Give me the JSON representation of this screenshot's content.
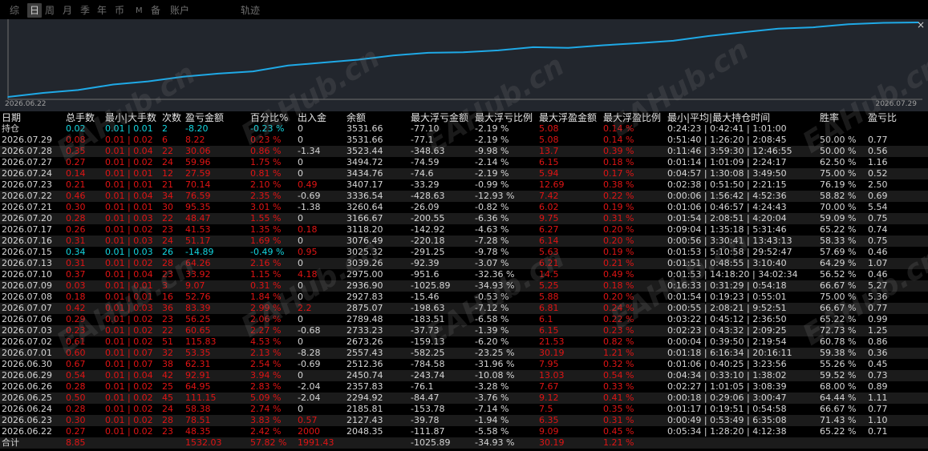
{
  "tabs": [
    {
      "label": "综",
      "active": false
    },
    {
      "label": "日",
      "active": true
    },
    {
      "label": "周",
      "active": false
    },
    {
      "label": "月",
      "active": false
    },
    {
      "label": "季",
      "active": false
    },
    {
      "label": "年",
      "active": false
    },
    {
      "label": "币",
      "active": false
    },
    {
      "label": "M",
      "active": false
    },
    {
      "label": "备",
      "active": false
    },
    {
      "label": "账户",
      "active": false
    },
    {
      "label": "轨迹",
      "active": false
    }
  ],
  "chart": {
    "close_label": "×",
    "x_start_label": "2026.06.22",
    "x_end_label": "2026.07.29",
    "line_color": "#1fa9e6",
    "background": "#22262d",
    "chart_data": {
      "type": "line",
      "x": [
        "2026.06.22",
        "2026.06.23",
        "2026.06.24",
        "2026.06.25",
        "2026.06.26",
        "2026.06.29",
        "2026.06.30",
        "2026.07.01",
        "2026.07.02",
        "2026.07.03",
        "2026.07.06",
        "2026.07.07",
        "2026.07.08",
        "2026.07.09",
        "2026.07.10",
        "2026.07.13",
        "2026.07.15",
        "2026.07.16",
        "2026.07.17",
        "2026.07.20",
        "2026.07.21",
        "2026.07.22",
        "2026.07.23",
        "2026.07.24",
        "2026.07.27",
        "2026.07.28",
        "2026.07.29"
      ],
      "values": [
        2048.35,
        2127.43,
        2185.81,
        2294.92,
        2357.83,
        2450.74,
        2512.36,
        2557.43,
        2673.26,
        2733.23,
        2789.48,
        2875.07,
        2927.83,
        2936.9,
        2975.0,
        3039.26,
        3025.32,
        3076.49,
        3118.2,
        3166.67,
        3260.64,
        3336.54,
        3407.37,
        3434.76,
        3494.72,
        3523.44,
        3531.66
      ]
    }
  },
  "headers": [
    "日期",
    "总手数",
    "最小|大手数",
    "次数",
    "盈亏金额",
    "百分比%",
    "出入金",
    "余额",
    "最大浮亏金额",
    "最大浮亏比例",
    "最大浮盈金额",
    "最大浮盈比例",
    "最小|平均|最大持仓时间",
    "胜率",
    "盈亏比"
  ],
  "holding": [
    "持仓",
    "0.02",
    "0.01 | 0.01",
    "2",
    "-8.20",
    "-0.23 %",
    "0",
    "3531.66",
    "-77.10",
    "-2.19 %",
    "5.08",
    "0.14 %",
    "0:24:23 | 0:42:41 | 1:01:00",
    "",
    ""
  ],
  "rows": [
    [
      "2026.07.29",
      "0.08",
      "0.01 | 0.02",
      "6",
      "8.22",
      "0.23 %",
      "0",
      "3531.66",
      "-77.1",
      "-2.19 %",
      "5.08",
      "0.14 %",
      "0:51:40 | 1:26:20 | 2:08:45",
      "50.00 %",
      "0.77"
    ],
    [
      "2026.07.28",
      "0.35",
      "0.01 | 0.04",
      "22",
      "30.06",
      "0.86 %",
      "-1.34",
      "3523.44",
      "-348.63",
      "-9.98 %",
      "13.7",
      "0.39 %",
      "0:11:46 | 3:59:30 | 12:46:55",
      "50.00 %",
      "0.56"
    ],
    [
      "2026.07.27",
      "0.27",
      "0.01 | 0.02",
      "24",
      "59.96",
      "1.75 %",
      "0",
      "3494.72",
      "-74.59",
      "-2.14 %",
      "6.15",
      "0.18 %",
      "0:01:14 | 1:01:09 | 2:24:17",
      "62.50 %",
      "1.16"
    ],
    [
      "2026.07.24",
      "0.14",
      "0.01 | 0.01",
      "12",
      "27.59",
      "0.81 %",
      "0",
      "3434.76",
      "-74.6",
      "-2.19 %",
      "5.94",
      "0.17 %",
      "0:04:57 | 1:30:08 | 3:49:50",
      "75.00 %",
      "0.52"
    ],
    [
      "2026.07.23",
      "0.21",
      "0.01 | 0.01",
      "21",
      "70.14",
      "2.10 %",
      "0.49",
      "3407.17",
      "-33.29",
      "-0.99 %",
      "12.69",
      "0.38 %",
      "0:02:38 | 0:51:50 | 2:21:15",
      "76.19 %",
      "2.50"
    ],
    [
      "2026.07.22",
      "0.46",
      "0.01 | 0.04",
      "34",
      "76.59",
      "2.35 %",
      "-0.69",
      "3336.54",
      "-428.63",
      "-12.93 %",
      "7.42",
      "0.22 %",
      "0:00:06 | 1:56:42 | 4:52:36",
      "58.82 %",
      "0.69"
    ],
    [
      "2026.07.21",
      "0.30",
      "0.01 | 0.01",
      "30",
      "95.35",
      "3.01 %",
      "-1.38",
      "3260.64",
      "-26.09",
      "-0.82 %",
      "6.02",
      "0.19 %",
      "0:01:06 | 0:46:57 | 4:24:43",
      "70.00 %",
      "5.54"
    ],
    [
      "2026.07.20",
      "0.28",
      "0.01 | 0.03",
      "22",
      "48.47",
      "1.55 %",
      "0",
      "3166.67",
      "-200.55",
      "-6.36 %",
      "9.75",
      "0.31 %",
      "0:01:54 | 2:08:51 | 4:20:04",
      "59.09 %",
      "0.75"
    ],
    [
      "2026.07.17",
      "0.26",
      "0.01 | 0.02",
      "23",
      "41.53",
      "1.35 %",
      "0.18",
      "3118.20",
      "-142.92",
      "-4.63 %",
      "6.27",
      "0.20 %",
      "0:09:04 | 1:35:18 | 5:31:46",
      "65.22 %",
      "0.74"
    ],
    [
      "2026.07.16",
      "0.31",
      "0.01 | 0.03",
      "24",
      "51.17",
      "1.69 %",
      "0",
      "3076.49",
      "-220.18",
      "-7.28 %",
      "6.14",
      "0.20 %",
      "0:00:56 | 3:30:41 | 13:43:13",
      "58.33 %",
      "0.75"
    ],
    [
      "2026.07.15",
      "0.34",
      "0.01 | 0.03",
      "26",
      "-14.89",
      "-0.49 %",
      "0.95",
      "3025.32",
      "-291.25",
      "-9.78 %",
      "5.63",
      "0.19 %",
      "0:01:53 | 5:10:58 | 29:52:47",
      "57.69 %",
      "0.46"
    ],
    [
      "2026.07.13",
      "0.31",
      "0.01 | 0.02",
      "28",
      "64.26",
      "2.16 %",
      "0",
      "3039.26",
      "-92.39",
      "-3.07 %",
      "6.21",
      "0.21 %",
      "0:01:51 | 0:48:55 | 3:10:40",
      "64.29 %",
      "1.07"
    ],
    [
      "2026.07.10",
      "0.37",
      "0.01 | 0.04",
      "23",
      "33.92",
      "1.15 %",
      "4.18",
      "2975.00",
      "-951.6",
      "-32.36 %",
      "14.5",
      "0.49 %",
      "0:01:53 | 14:18:20 | 34:02:34",
      "56.52 %",
      "0.46"
    ],
    [
      "2026.07.09",
      "0.03",
      "0.01 | 0.01",
      "3",
      "9.07",
      "0.31 %",
      "0",
      "2936.90",
      "-1025.89",
      "-34.93 %",
      "5.25",
      "0.18 %",
      "0:16:33 | 0:31:29 | 0:54:18",
      "66.67 %",
      "5.27"
    ],
    [
      "2026.07.08",
      "0.18",
      "0.01 | 0.01",
      "16",
      "52.76",
      "1.84 %",
      "0",
      "2927.83",
      "-15.46",
      "-0.53 %",
      "5.88",
      "0.20 %",
      "0:01:54 | 0:19:23 | 0:55:01",
      "75.00 %",
      "5.36"
    ],
    [
      "2026.07.07",
      "0.42",
      "0.01 | 0.03",
      "36",
      "83.39",
      "2.99 %",
      "2.2",
      "2875.07",
      "-198.63",
      "-7.12 %",
      "6.81",
      "0.24 %",
      "0:00:55 | 2:08:21 | 9:52:51",
      "66.67 %",
      "0.77"
    ],
    [
      "2026.07.06",
      "0.29",
      "0.01 | 0.02",
      "23",
      "56.25",
      "2.06 %",
      "0",
      "2789.48",
      "-183.51",
      "-6.58 %",
      "6.1",
      "0.22 %",
      "0:03:22 | 0:45:12 | 2:36:50",
      "65.22 %",
      "0.99"
    ],
    [
      "2026.07.03",
      "0.23",
      "0.01 | 0.02",
      "22",
      "60.65",
      "2.27 %",
      "-0.68",
      "2733.23",
      "-37.73",
      "-1.39 %",
      "6.15",
      "0.23 %",
      "0:02:23 | 0:43:32 | 2:09:25",
      "72.73 %",
      "1.25"
    ],
    [
      "2026.07.02",
      "0.61",
      "0.01 | 0.02",
      "51",
      "115.83",
      "4.53 %",
      "0",
      "2673.26",
      "-159.13",
      "-6.20 %",
      "21.53",
      "0.82 %",
      "0:00:04 | 0:39:50 | 2:19:54",
      "60.78 %",
      "0.86"
    ],
    [
      "2026.07.01",
      "0.60",
      "0.01 | 0.07",
      "32",
      "53.35",
      "2.13 %",
      "-8.28",
      "2557.43",
      "-582.25",
      "-23.25 %",
      "30.19",
      "1.21 %",
      "0:01:18 | 6:16:34 | 20:16:11",
      "59.38 %",
      "0.36"
    ],
    [
      "2026.06.30",
      "0.67",
      "0.01 | 0.07",
      "38",
      "62.31",
      "2.54 %",
      "-0.69",
      "2512.36",
      "-784.58",
      "-31.96 %",
      "7.95",
      "0.32 %",
      "0:01:06 | 0:40:25 | 3:23:56",
      "55.26 %",
      "0.45"
    ],
    [
      "2026.06.29",
      "0.54",
      "0.01 | 0.04",
      "42",
      "92.91",
      "3.94 %",
      "0",
      "2450.74",
      "-243.74",
      "-10.08 %",
      "13.03",
      "0.54 %",
      "0:04:34 | 0:33:10 | 1:38:02",
      "59.52 %",
      "0.73"
    ],
    [
      "2026.06.26",
      "0.28",
      "0.01 | 0.02",
      "25",
      "64.95",
      "2.83 %",
      "-2.04",
      "2357.83",
      "-76.1",
      "-3.28 %",
      "7.67",
      "0.33 %",
      "0:02:27 | 1:01:05 | 3:08:39",
      "68.00 %",
      "0.89"
    ],
    [
      "2026.06.25",
      "0.50",
      "0.01 | 0.02",
      "45",
      "111.15",
      "5.09 %",
      "-2.04",
      "2294.92",
      "-84.47",
      "-3.76 %",
      "9.12",
      "0.41 %",
      "0:00:18 | 0:29:06 | 3:00:47",
      "64.44 %",
      "1.11"
    ],
    [
      "2026.06.24",
      "0.28",
      "0.01 | 0.02",
      "24",
      "58.38",
      "2.74 %",
      "0",
      "2185.81",
      "-153.78",
      "-7.14 %",
      "7.5",
      "0.35 %",
      "0:01:17 | 0:19:51 | 0:54:58",
      "66.67 %",
      "0.77"
    ],
    [
      "2026.06.23",
      "0.30",
      "0.01 | 0.02",
      "28",
      "78.51",
      "3.83 %",
      "0.57",
      "2127.43",
      "-39.78",
      "-1.94 %",
      "6.35",
      "0.31 %",
      "0:00:49 | 0:53:49 | 6:35:08",
      "71.43 %",
      "1.10"
    ],
    [
      "2026.06.22",
      "0.27",
      "0.01 | 0.02",
      "23",
      "48.35",
      "2.42 %",
      "2000",
      "2048.35",
      "-111.87",
      "-5.58 %",
      "9.09",
      "0.45 %",
      "0:05:34 | 1:28:20 | 4:12:38",
      "65.22 %",
      "0.71"
    ]
  ],
  "total": [
    "合计",
    "8.85",
    "",
    "",
    "1532.03",
    "57.82 %",
    "1991.43",
    "",
    "-1025.89",
    "-34.93 %",
    "30.19",
    "1.21 %",
    "",
    "",
    ""
  ],
  "watermark_text": "EAHub.cn",
  "colors": {
    "profit": "#e01414",
    "loss": "#13d6e0",
    "neutral": "#d6d6d6"
  }
}
